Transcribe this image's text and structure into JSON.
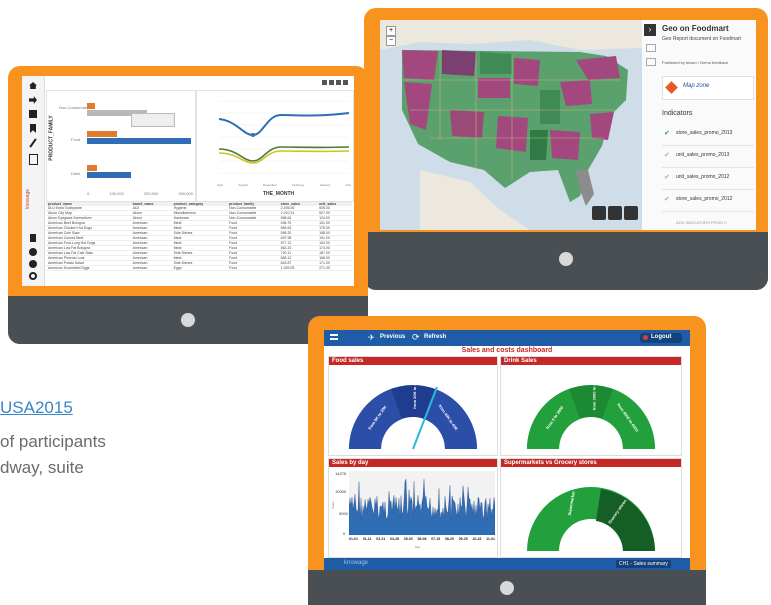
{
  "left_text": {
    "link": "USA2015",
    "line1": "of participants",
    "line2": "dway, suite"
  },
  "tablet1": {
    "toolbar_icons": [
      "home-icon",
      "share-icon",
      "save-icon",
      "bookmark-icon",
      "edit-icon",
      "document-icon"
    ],
    "bottom_icons": [
      "flag-icon",
      "help-icon",
      "info-icon",
      "settings-icon"
    ],
    "brand": "knowage",
    "chart_left": {
      "ylabel": "PRODUCT_FAMILY",
      "categories": [
        "Non-Consumable",
        "Food",
        "Drink"
      ],
      "x_ticks": [
        "0",
        "100,000",
        "200,000",
        "300,000"
      ]
    },
    "chart_right": {
      "xlabel": "THE_MONTH",
      "y_ticks": [
        "200,000",
        "175,000",
        "150,000",
        "125,000",
        "100,000",
        "75,000",
        "50,000",
        "25,000",
        "0"
      ],
      "x_ticks": [
        "April",
        "August",
        "December",
        "February",
        "January",
        "July",
        "June",
        "March",
        "May",
        "November",
        "October",
        "September"
      ]
    },
    "table": {
      "headers": [
        "product_name",
        "brand_name",
        "product_category",
        "product_family",
        "store_sales",
        "unit_sales"
      ],
      "rows": [
        [
          "ADJ Extra Toothpaste",
          "ADJ",
          "Hygiene",
          "Non-Consumable",
          "2,195.06",
          "505.00"
        ],
        [
          "Akron City Map",
          "Akron",
          "Miscellaneous",
          "Non-Consumable",
          "2,210.24",
          "527.00"
        ],
        [
          "Akron Eyeglass Screwdriver",
          "Akron",
          "Hardware",
          "Non-Consumable",
          "568.64",
          "124.00"
        ],
        [
          "American Beef Bologna",
          "American",
          "Meat",
          "Food",
          "496.75",
          "131.00"
        ],
        [
          "American Chicken Hot Dogs",
          "American",
          "Meat",
          "Food",
          "665.63",
          "175.00"
        ],
        [
          "American Cole Slaw",
          "American",
          "Side Dishes",
          "Food",
          "595.32",
          "158.00"
        ],
        [
          "American Corned Beef",
          "American",
          "Meat",
          "Food",
          "697.98",
          "191.00"
        ],
        [
          "American Foot-Long Hot Dogs",
          "American",
          "Meat",
          "Food",
          "577.12",
          "152.00"
        ],
        [
          "American Low Fat Bologna",
          "American",
          "Meat",
          "Food",
          "662.20",
          "174.00"
        ],
        [
          "American Low Fat Cole Slaw",
          "American",
          "Side Dishes",
          "Food",
          "720.11",
          "187.00"
        ],
        [
          "American Pimento Loaf",
          "American",
          "Meat",
          "Food",
          "658.12",
          "168.00"
        ],
        [
          "American Potato Salad",
          "American",
          "Side Dishes",
          "Food",
          "643.87",
          "171.00"
        ],
        [
          "American Scrambled Eggs",
          "American",
          "Eggs",
          "Food",
          "1,039.05",
          "271.00"
        ]
      ]
    }
  },
  "tablet2": {
    "title": "Geo on Foodmart",
    "subtitle": "Geo Report document on Foodmart",
    "published": "Published by biuser / Demo feedback",
    "map_zone_label": "Map zone",
    "indicators_title": "Indicators",
    "indicators": [
      "store_sales_promo_2013",
      "unit_sales_promo_2013",
      "unit_sales_promo_2012",
      "store_sales_promo_2012"
    ],
    "add_indicators": "ADD INDICATORS FROM C"
  },
  "tablet3": {
    "toolbar": {
      "previous": "Previous",
      "refresh": "Refresh",
      "logout": "Logout"
    },
    "title": "Sales and costs dashboard",
    "panels": {
      "food": "Food sales",
      "drink": "Drink Sales",
      "day": "Sales by day",
      "super": "Supermarkets vs Grocery stores"
    },
    "food_gauge_labels": [
      "from 0K to 20K",
      "from 20K to 40K",
      "from 40K to 60K"
    ],
    "drink_gauge_labels": [
      "from 0 to 2000",
      "from 2000 to 4000",
      "from 4000 to 6000"
    ],
    "super_gauge_labels": [
      "Supermarket",
      "Grocery stores"
    ],
    "day_chart": {
      "y_ticks": [
        "14275",
        "10000",
        "5000",
        "0"
      ],
      "ylabel": "Sales",
      "x_ticks": [
        "01-01",
        "01-11",
        "02-21",
        "03-28",
        "05-03",
        "06-08",
        "07-15",
        "08-20",
        "09-25",
        "10-23",
        "11-01"
      ],
      "xlabel": "Day"
    },
    "footer_brand": "knowage",
    "footer_tag": "CH1 - Sales summary"
  },
  "colors": {
    "tablet_frame": "#f7931e",
    "bezel": "#4a4f54",
    "dash_blue": "#1e5ca8",
    "header_red": "#c62828",
    "gauge_blue": "#1f3c8f",
    "gauge_green": "#1c8a33"
  }
}
